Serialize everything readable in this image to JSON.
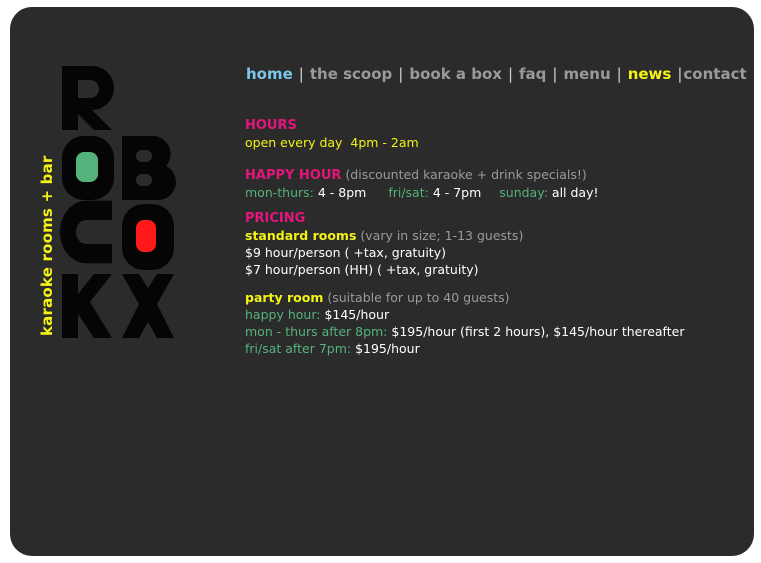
{
  "brand": {
    "tagline": "karaoke rooms + bar",
    "logo_letters": [
      "R",
      "O",
      "B",
      "O",
      "C",
      "O",
      "K",
      "X"
    ],
    "colors": {
      "yellow": "#f3f315",
      "pink": "#e4157c",
      "green": "#55b27b",
      "red": "#ff1a1a",
      "blue": "#7cc6ea"
    }
  },
  "nav": {
    "items": [
      "home",
      "the scoop",
      "book a box",
      "faq",
      "menu",
      "news",
      "contact"
    ],
    "separator": "|"
  },
  "hours": {
    "title": "HOURS",
    "text": "open every day  4pm - 2am"
  },
  "happy_hour": {
    "title": "HAPPY HOUR",
    "subtitle": "(discounted karaoke + drink specials!)",
    "schedule": [
      {
        "day": "mon-thurs:",
        "time": "4 - 8pm"
      },
      {
        "day": "fri/sat:",
        "time": "4 - 7pm"
      },
      {
        "day": "sunday:",
        "time": "all day!"
      }
    ]
  },
  "pricing": {
    "title": "PRICING",
    "standard": {
      "label": "standard rooms",
      "note": "(vary in size; 1-13 guests)",
      "lines": [
        "$9 hour/person ( +tax, gratuity)",
        "$7 hour/person (HH) ( +tax, gratuity)"
      ]
    },
    "party": {
      "label": "party room",
      "note": "(suitable for up to 40 guests)",
      "lines": [
        {
          "label": "happy hour:",
          "value": "$145/hour"
        },
        {
          "label": "mon - thurs after 8pm:",
          "value": "$195/hour (first 2 hours), $145/hour thereafter"
        },
        {
          "label": "fri/sat after 7pm:",
          "value": "$195/hour"
        }
      ]
    }
  }
}
